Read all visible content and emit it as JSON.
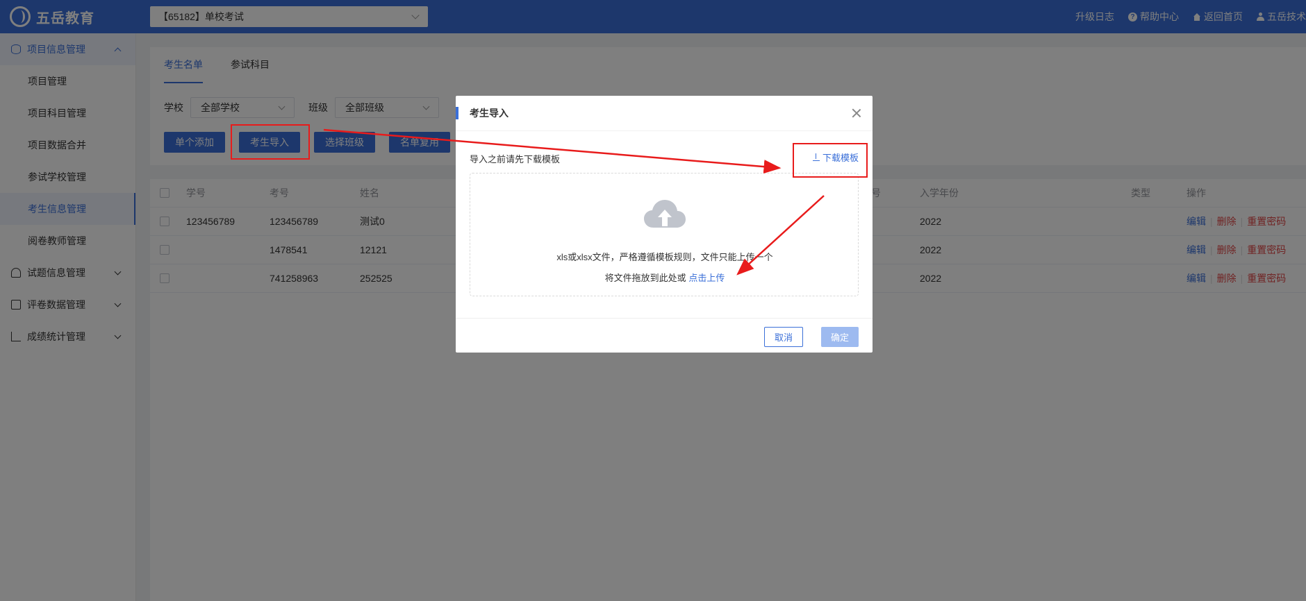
{
  "app": {
    "logo_text": "五岳教育"
  },
  "header": {
    "exam_select": "【65182】单校考试",
    "links": [
      "升级日志",
      "帮助中心",
      "返回首页",
      "五岳技术"
    ]
  },
  "sidebar": {
    "group_project": "项目信息管理",
    "items": [
      "项目管理",
      "项目科目管理",
      "项目数据合并",
      "参试学校管理",
      "考生信息管理",
      "阅卷教师管理"
    ],
    "group_questions": "试题信息管理",
    "group_grading": "评卷数据管理",
    "group_scores": "成绩统计管理"
  },
  "tabs": [
    "考生名单",
    "参试科目"
  ],
  "filters": {
    "school_label": "学校",
    "school_value": "全部学校",
    "class_label": "班级",
    "class_value": "全部班级"
  },
  "actions": [
    "单个添加",
    "考生导入",
    "选择班级",
    "名单复用"
  ],
  "table": {
    "headers": {
      "student_id": "学号",
      "exam_no": "考号",
      "name": "姓名",
      "partial_col": "号",
      "year": "入学年份",
      "type": "类型",
      "ops": "操作"
    },
    "rows": [
      {
        "student_id": "123456789",
        "exam_no": "123456789",
        "name": "测试0",
        "year": "2022"
      },
      {
        "student_id": "",
        "exam_no": "1478541",
        "name": "12121",
        "year": "2022"
      },
      {
        "student_id": "",
        "exam_no": "741258963",
        "name": "252525",
        "year": "2022"
      }
    ],
    "op_edit": "编辑",
    "op_delete": "删除",
    "op_reset": "重置密码"
  },
  "modal": {
    "title": "考生导入",
    "hint": "导入之前请先下载模板",
    "download_label": "下载模板",
    "drop_text": "xls或xlsx文件，严格遵循模板规则，文件只能上传一个",
    "drop_prefix": "将文件拖放到此处或",
    "upload_link": "点击上传",
    "cancel": "取消",
    "confirm": "确定"
  },
  "colors": {
    "primary": "#3a6fd8",
    "annotation": "#e81b1b",
    "danger": "#e04646"
  }
}
